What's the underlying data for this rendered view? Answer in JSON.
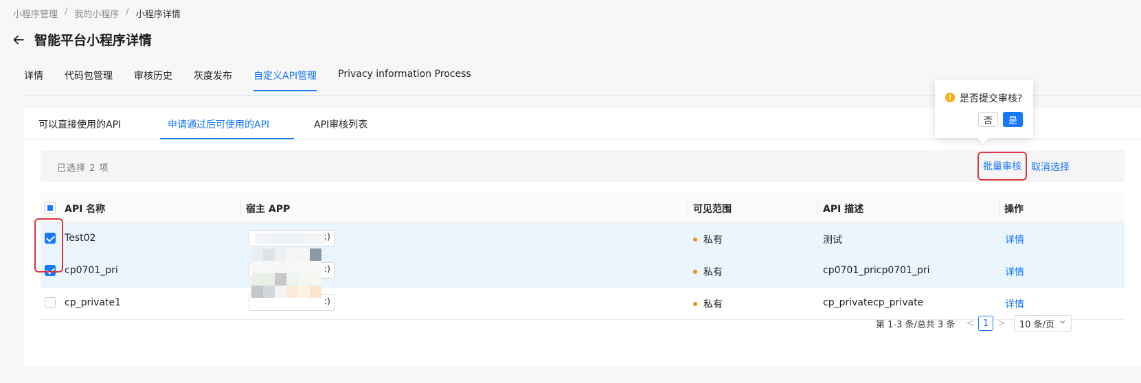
{
  "breadcrumb": {
    "items": [
      "小程序管理",
      "我的小程序",
      "小程序详情"
    ],
    "separator": "/"
  },
  "page": {
    "title": "智能平台小程序详情"
  },
  "tabs": [
    {
      "label": "详情"
    },
    {
      "label": "代码包管理"
    },
    {
      "label": "审核历史"
    },
    {
      "label": "灰度发布"
    },
    {
      "label": "自定义API管理",
      "active": true
    },
    {
      "label": "Privacy information Process"
    }
  ],
  "subtabs": [
    {
      "label": "可以直接使用的API"
    },
    {
      "label": "申请通过后可使用的API",
      "active": true
    },
    {
      "label": "API审核列表"
    }
  ],
  "selection": {
    "text": "已选择  2  项",
    "batch_label": "批量审核",
    "cancel_label": "取消选择"
  },
  "table": {
    "columns": [
      "API 名称",
      "宿主 APP",
      "可见范围",
      "API 描述",
      "操作"
    ],
    "rows": [
      {
        "name": "Test02",
        "host_suffix": ":)",
        "scope": "私有",
        "desc": "测试",
        "action": "详情",
        "checked": true
      },
      {
        "name": "cp0701_pri",
        "host_suffix": ":)",
        "scope": "私有",
        "desc": "cp0701_pricp0701_pri",
        "action": "详情",
        "checked": true
      },
      {
        "name": "cp_private1",
        "host_suffix": ":)",
        "scope": "私有",
        "desc": "cp_privatecp_private",
        "action": "详情",
        "checked": false
      }
    ]
  },
  "pagination": {
    "summary": "第 1-3 条/总共 3 条",
    "current": "1",
    "page_size": "10 条/页",
    "prev": "<",
    "next": ">"
  },
  "popover": {
    "icon": "!",
    "text": "是否提交审核?",
    "no_label": "否",
    "yes_label": "是"
  },
  "colors": {
    "primary": "#1677ff",
    "warning": "#faad14",
    "dot": "#fa8c16",
    "highlight": "#d9363e",
    "selected_row": "#eaf5fd"
  },
  "icons": {
    "back": "arrow-left-icon",
    "popover": "exclamation-circle-icon",
    "dropdown": "chevron-down-icon"
  }
}
